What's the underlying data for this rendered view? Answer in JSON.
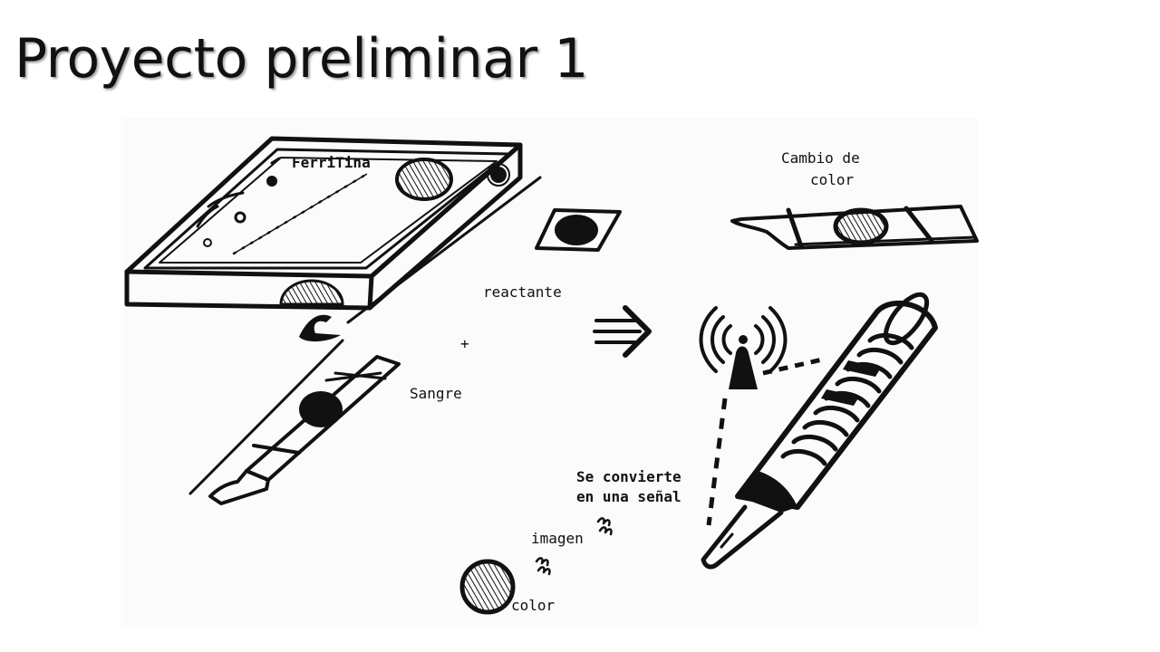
{
  "slide": {
    "title": "Proyecto preliminar 1"
  },
  "sketch": {
    "device_label": "FerriTina",
    "reactant_label": "reactante",
    "blood_label": "Sangre",
    "plus": "+",
    "color_change_line1": "Cambio de",
    "color_change_line2": "color",
    "signal_line1": "Se convierte",
    "signal_line2": "en una señal",
    "image_label": "imagen",
    "color_label": "color"
  },
  "colors": {
    "ink": "#111111",
    "paper": "#fbfbfb",
    "background": "#ffffff"
  }
}
